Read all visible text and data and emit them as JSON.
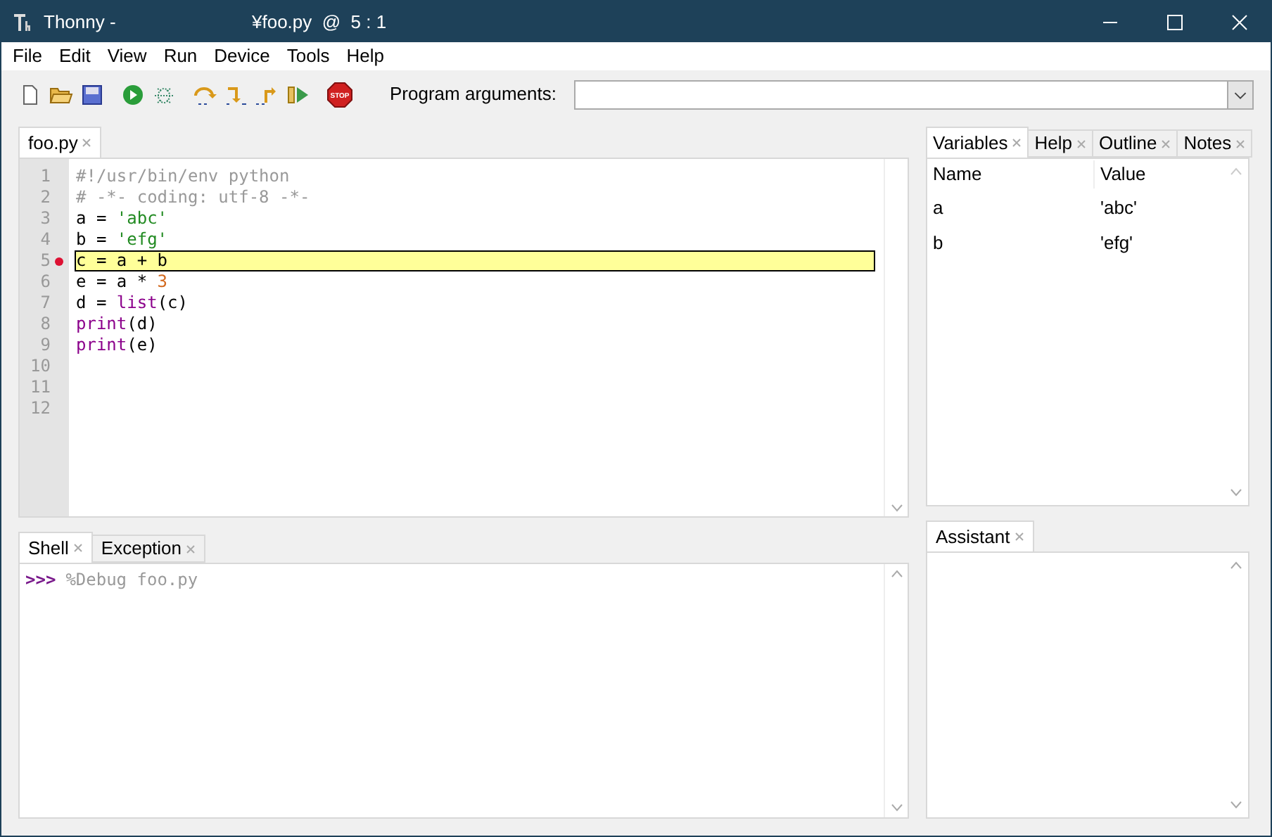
{
  "window": {
    "title_app": "Thonny  -",
    "title_file": "¥foo.py  @  5 : 1"
  },
  "menu": [
    "File",
    "Edit",
    "View",
    "Run",
    "Device",
    "Tools",
    "Help"
  ],
  "toolbar": {
    "buttons": [
      {
        "kind": "new"
      },
      {
        "kind": "open"
      },
      {
        "kind": "save"
      },
      {
        "kind": "run"
      },
      {
        "kind": "debug"
      },
      {
        "kind": "step_over"
      },
      {
        "kind": "step_into"
      },
      {
        "kind": "step_out"
      },
      {
        "kind": "resume"
      },
      {
        "kind": "stop",
        "label": "STOP"
      }
    ],
    "args_label": "Program arguments:"
  },
  "editor": {
    "tabs": [
      {
        "label": "foo.py",
        "selected": true
      }
    ],
    "lines": [
      {
        "number": "1",
        "tokens": [
          {
            "kind": "comment",
            "text": "#!/usr/bin/env python"
          }
        ]
      },
      {
        "number": "2",
        "tokens": [
          {
            "kind": "comment",
            "text": "# -*- coding: utf-8 -*-"
          }
        ]
      },
      {
        "number": "3",
        "tokens": [
          {
            "kind": "plain",
            "text": "a = "
          },
          {
            "kind": "string",
            "text": "'abc'"
          }
        ]
      },
      {
        "number": "4",
        "tokens": [
          {
            "kind": "plain",
            "text": "b = "
          },
          {
            "kind": "string",
            "text": "'efg'"
          }
        ]
      },
      {
        "number": "5",
        "breakpoint": true,
        "current": true,
        "tokens": [
          {
            "kind": "plain",
            "text": "c = a + b"
          }
        ]
      },
      {
        "number": "6",
        "tokens": [
          {
            "kind": "plain",
            "text": "e = a * "
          },
          {
            "kind": "number",
            "text": "3"
          }
        ]
      },
      {
        "number": "7",
        "tokens": [
          {
            "kind": "plain",
            "text": "d = "
          },
          {
            "kind": "builtin",
            "text": "list"
          },
          {
            "kind": "plain",
            "text": "(c)"
          }
        ]
      },
      {
        "number": "8",
        "tokens": [
          {
            "kind": "builtin",
            "text": "print"
          },
          {
            "kind": "plain",
            "text": "(d)"
          }
        ]
      },
      {
        "number": "9",
        "tokens": [
          {
            "kind": "builtin",
            "text": "print"
          },
          {
            "kind": "plain",
            "text": "(e)"
          }
        ]
      },
      {
        "number": "10"
      },
      {
        "number": "11"
      },
      {
        "number": "12"
      }
    ]
  },
  "shell": {
    "tabs": [
      {
        "label": "Shell",
        "selected": true
      },
      {
        "label": "Exception",
        "selected": false
      }
    ],
    "prompt": ">>>",
    "command": "%Debug foo.py"
  },
  "right_panel": {
    "tabs": [
      {
        "label": "Variables",
        "selected": true
      },
      {
        "label": "Help",
        "selected": false
      },
      {
        "label": "Outline",
        "selected": false
      },
      {
        "label": "Notes",
        "selected": false
      }
    ],
    "columns": [
      "Name",
      "Value"
    ],
    "rows": [
      {
        "name": "a",
        "value": "'abc'"
      },
      {
        "name": "b",
        "value": "'efg'"
      }
    ]
  },
  "assistant": {
    "tabs": [
      {
        "label": "Assistant",
        "selected": true
      }
    ]
  }
}
